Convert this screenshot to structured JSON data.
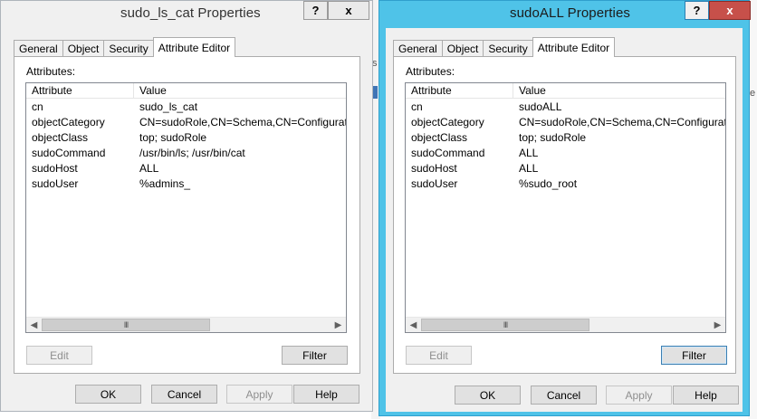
{
  "dialogs": [
    {
      "title": "sudo_ls_cat Properties",
      "title_buttons": {
        "help": "?",
        "close": "x"
      },
      "tabs": [
        "General",
        "Object",
        "Security",
        "Attribute Editor"
      ],
      "active_tab": "Attribute Editor",
      "attributes_label": "Attributes:",
      "columns": [
        "Attribute",
        "Value"
      ],
      "rows": [
        {
          "attribute": "cn",
          "value": "sudo_ls_cat"
        },
        {
          "attribute": "objectCategory",
          "value": "CN=sudoRole,CN=Schema,CN=Configuration,DC"
        },
        {
          "attribute": "objectClass",
          "value": "top; sudoRole"
        },
        {
          "attribute": "sudoCommand",
          "value": "/usr/bin/ls; /usr/bin/cat"
        },
        {
          "attribute": "sudoHost",
          "value": "ALL"
        },
        {
          "attribute": "sudoUser",
          "value": "%admins_"
        }
      ],
      "scroll_thumb": "III",
      "edit_label": "Edit",
      "filter_label": "Filter",
      "ok_label": "OK",
      "cancel_label": "Cancel",
      "apply_label": "Apply",
      "help_label": "Help"
    },
    {
      "title": "sudoALL Properties",
      "title_buttons": {
        "help": "?",
        "close": "x"
      },
      "tabs": [
        "General",
        "Object",
        "Security",
        "Attribute Editor"
      ],
      "active_tab": "Attribute Editor",
      "attributes_label": "Attributes:",
      "columns": [
        "Attribute",
        "Value"
      ],
      "rows": [
        {
          "attribute": "cn",
          "value": "sudoALL"
        },
        {
          "attribute": "objectCategory",
          "value": "CN=sudoRole,CN=Schema,CN=Configuration,DC"
        },
        {
          "attribute": "objectClass",
          "value": "top; sudoRole"
        },
        {
          "attribute": "sudoCommand",
          "value": "ALL"
        },
        {
          "attribute": "sudoHost",
          "value": "ALL"
        },
        {
          "attribute": "sudoUser",
          "value": "%sudo_root"
        }
      ],
      "scroll_thumb": "III",
      "edit_label": "Edit",
      "filter_label": "Filter",
      "ok_label": "OK",
      "cancel_label": "Cancel",
      "apply_label": "Apply",
      "help_label": "Help"
    }
  ],
  "colors": {
    "active_titlebar": "#4fc3e8",
    "close_button_active": "#c7504a",
    "dialog_background": "#f0f0f0"
  },
  "background_fragments": [
    "s",
    "e"
  ]
}
